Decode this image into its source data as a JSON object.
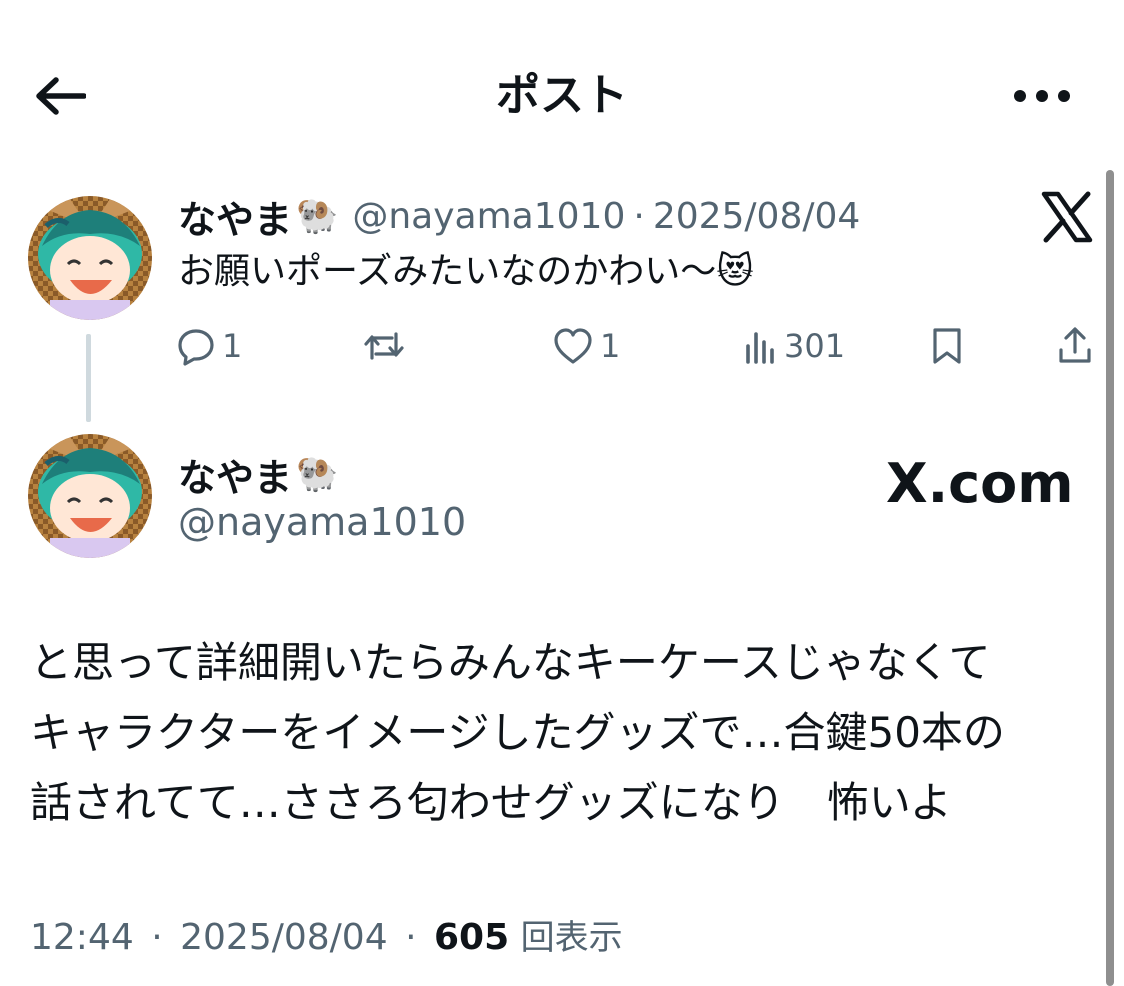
{
  "header": {
    "title": "ポスト",
    "back_icon": "arrow-left-icon",
    "more_icon": "more-horizontal-icon"
  },
  "parent_post": {
    "display_name": "なやま",
    "name_emoji": "🐏",
    "handle": "@nayama1010",
    "separator": "·",
    "date": "2025/08/04",
    "text": "お願いポーズみたいなのかわい〜",
    "text_emoji": "😻",
    "source_logo": "X",
    "actions": {
      "reply_count": "1",
      "repost_count": "",
      "like_count": "1",
      "view_count": "301"
    }
  },
  "main_post": {
    "display_name": "なやま",
    "name_emoji": "🐏",
    "handle": "@nayama1010",
    "brand": "X.com",
    "body_lines": [
      "と思って詳細開いたらみんなキーケースじゃなくて",
      "キャラクターをイメージしたグッズで…合鍵50本の",
      "話されてて…ささろ匂わせグッズになり　怖いよ"
    ],
    "time": "12:44",
    "separator": "·",
    "date": "2025/08/04",
    "view_count": "605",
    "view_unit": "回表示"
  },
  "colors": {
    "text": "#0f1419",
    "secondary": "#536471",
    "thread_line": "#cfd9de",
    "background": "#ffffff"
  }
}
